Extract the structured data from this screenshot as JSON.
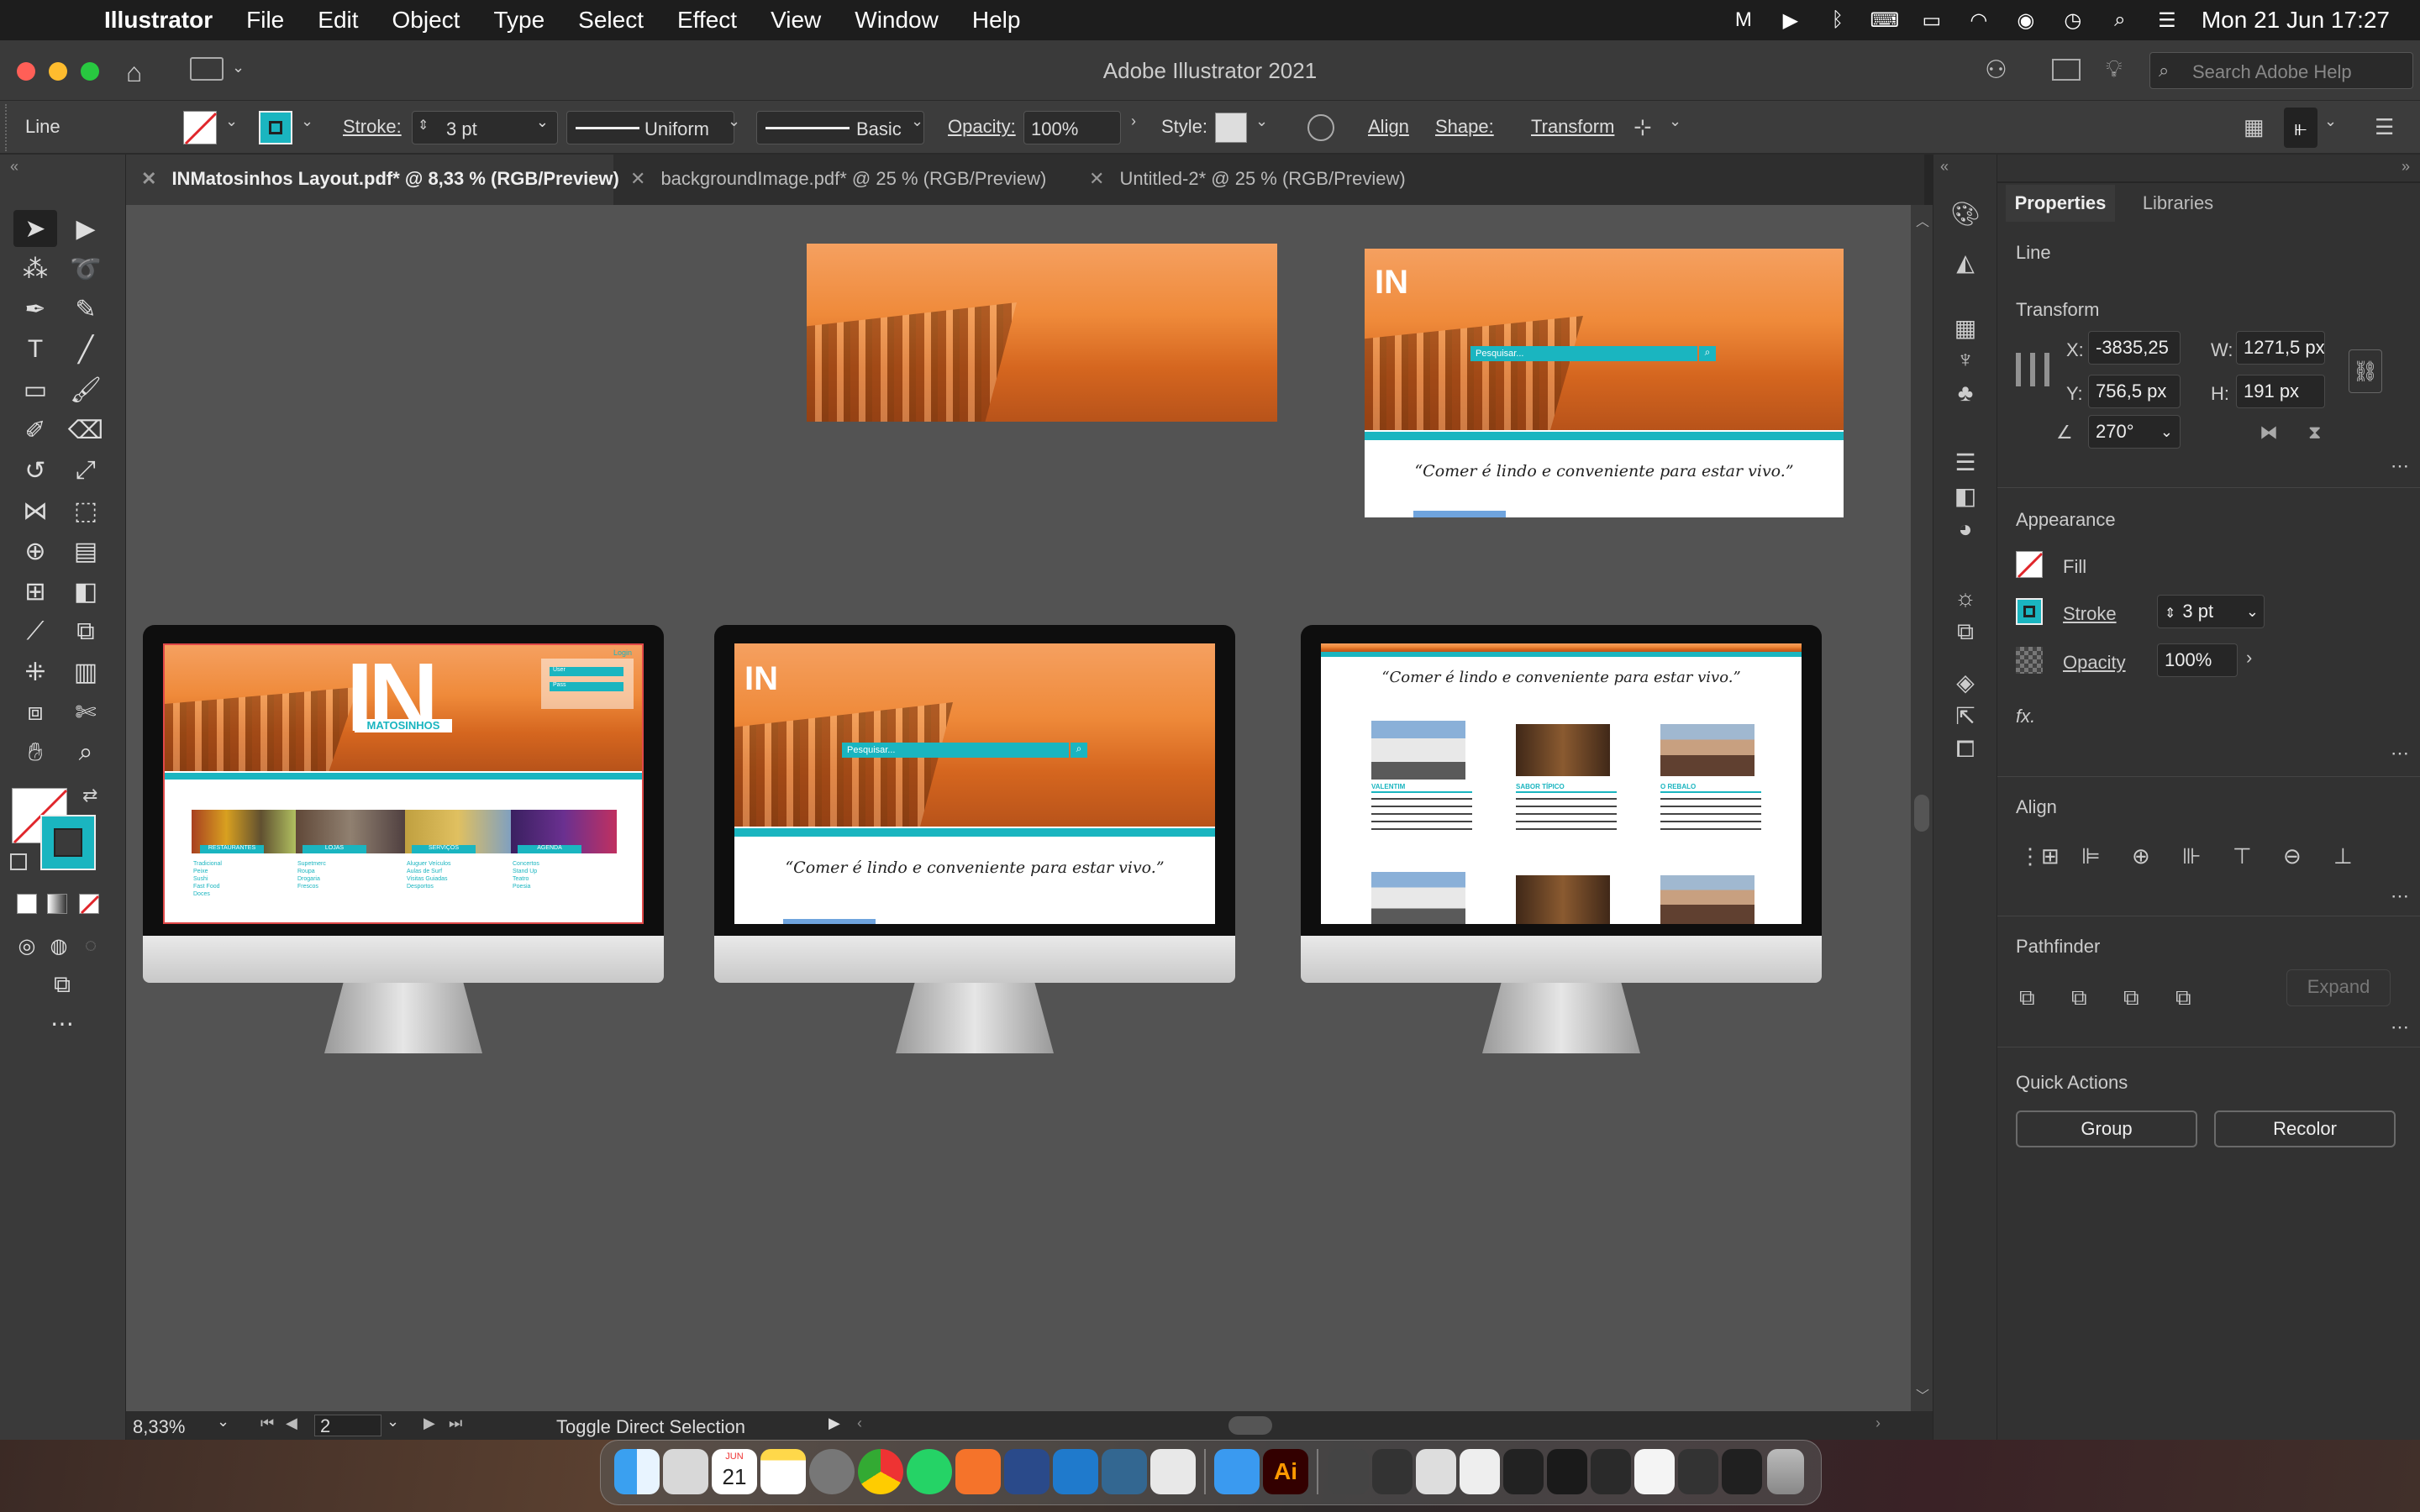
{
  "menubar": {
    "app": "Illustrator",
    "items": [
      "File",
      "Edit",
      "Object",
      "Type",
      "Select",
      "Effect",
      "View",
      "Window",
      "Help"
    ],
    "datetime": "Mon 21 Jun  17:27"
  },
  "window": {
    "title": "Adobe Illustrator 2021",
    "search_placeholder": "Search Adobe Help"
  },
  "control": {
    "selection": "Line",
    "stroke_label": "Stroke:",
    "stroke_value": "3 pt",
    "profile": "Uniform",
    "brush": "Basic",
    "opacity_label": "Opacity:",
    "opacity_value": "100%",
    "style_label": "Style:",
    "align": "Align",
    "shape": "Shape:",
    "transform": "Transform"
  },
  "tabs": [
    {
      "label": "INMatosinhos Layout.pdf* @ 8,33 % (RGB/Preview)"
    },
    {
      "label": "backgroundImage.pdf* @ 25 % (RGB/Preview)"
    },
    {
      "label": "Untitled-2* @ 25 % (RGB/Preview)"
    }
  ],
  "props": {
    "tab_properties": "Properties",
    "tab_libraries": "Libraries",
    "selection": "Line",
    "transform": "Transform",
    "x_label": "X:",
    "x": "-3835,25",
    "w_label": "W:",
    "w": "1271,5 px",
    "y_label": "Y:",
    "y": "756,5 px",
    "h_label": "H:",
    "h": "191 px",
    "angle": "270°",
    "appearance": "Appearance",
    "fill": "Fill",
    "stroke": "Stroke",
    "stroke_value": "3 pt",
    "opacity": "Opacity",
    "opacity_value": "100%",
    "fx": "fx.",
    "align": "Align",
    "pathfinder": "Pathfinder",
    "expand": "Expand",
    "quick_actions": "Quick Actions",
    "group": "Group",
    "recolor": "Recolor"
  },
  "status": {
    "zoom": "8,33%",
    "page": "2",
    "tool": "Toggle Direct Selection"
  },
  "artwork": {
    "quote": "“Comer é lindo e conveniente para estar vivo.”",
    "search": "Pesquisar...",
    "logo": "IN",
    "brand": "MATOSINHOS",
    "login": "Login",
    "user": "User",
    "pass": "Pass",
    "categories": [
      "RESTAURANTES",
      "LOJAS",
      "SERVIÇOS",
      "AGENDA"
    ],
    "cat_items": [
      [
        "Tradicional",
        "Peixe",
        "Sushi",
        "Fast Food",
        "Doces"
      ],
      [
        "Supetmerc",
        "Roupa",
        "Drogaria",
        "Frescos"
      ],
      [
        "Aluguer Veículos",
        "Aulas de Surf",
        "Visitas Guiadas",
        "Desportos"
      ],
      [
        "Concertos",
        "Stand Up",
        "Teatro",
        "Poesia"
      ]
    ],
    "restaurants": [
      "VALENTIM",
      "SABOR TÍPICO",
      "O REBALO"
    ],
    "colors": {
      "teal": "#1ab5c0",
      "orange": "#ef8a3a",
      "canvas": "#535353"
    }
  },
  "dock_badges": {
    "calendar_month": "JUN",
    "calendar_day": "21"
  }
}
